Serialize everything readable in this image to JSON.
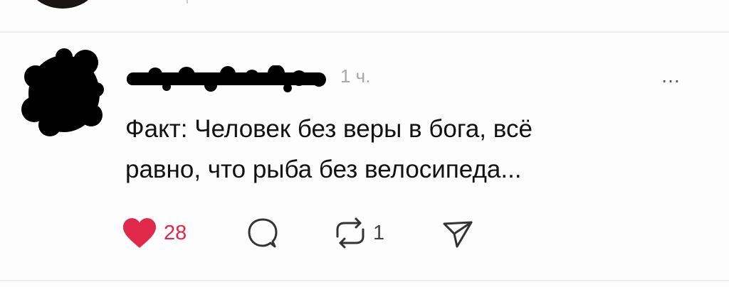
{
  "post": {
    "time": "1 ч.",
    "more_label": "…",
    "text_line1": "Факт: Человек без веры в бога, всё",
    "text_line2": "равно, что рыба без велосипеда..."
  },
  "actions": {
    "like_count": "28",
    "repost_count": "1"
  },
  "colors": {
    "like": "#e0294a",
    "text": "#111111",
    "muted": "#a8a8a8",
    "redaction": "#000000"
  },
  "icons": {
    "like": "heart-icon",
    "reply": "comment-bubble-icon",
    "repost": "repost-arrows-icon",
    "share": "send-arrow-icon"
  }
}
